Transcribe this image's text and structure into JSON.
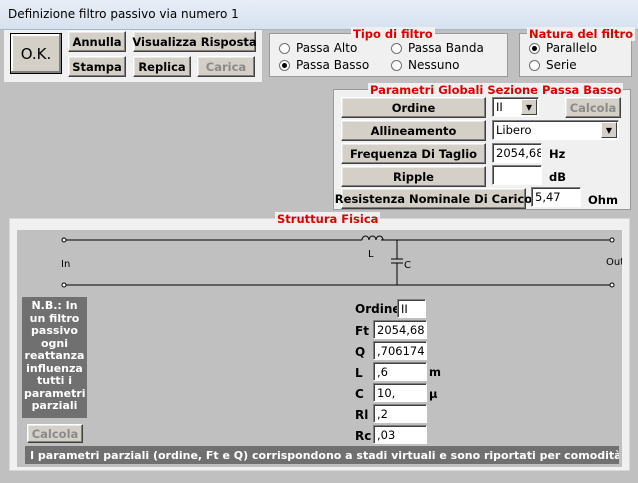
{
  "window": {
    "title": "Definizione filtro passivo via numero 1"
  },
  "toolbar": {
    "ok": "O.K.",
    "annulla": "Annulla",
    "visualizza": "Visualizza Risposta",
    "stampa": "Stampa",
    "replica": "Replica",
    "carica": "Carica"
  },
  "filter_type": {
    "title": "Tipo di filtro",
    "options": [
      {
        "label": "Passa Alto",
        "selected": false
      },
      {
        "label": "Passa Banda",
        "selected": false
      },
      {
        "label": "Passa Basso",
        "selected": true
      },
      {
        "label": "Nessuno",
        "selected": false
      }
    ]
  },
  "filter_nature": {
    "title": "Natura del filtro",
    "options": [
      {
        "label": "Parallelo",
        "selected": true
      },
      {
        "label": "Serie",
        "selected": false
      }
    ]
  },
  "global_params": {
    "title": "Parametri Globali Sezione Passa Basso",
    "ordine_label": "Ordine",
    "ordine_value": "II",
    "calcola": "Calcola",
    "allineamento_label": "Allineamento",
    "allineamento_value": "Libero",
    "freq_label": "Frequenza Di Taglio",
    "freq_value": "2054,68",
    "freq_unit": "Hz",
    "ripple_label": "Ripple",
    "ripple_value": "",
    "ripple_unit": "dB",
    "resist_label": "Resistenza Nominale Di Carico",
    "resist_value": "5,47",
    "resist_unit": "Ohm"
  },
  "structure": {
    "title": "Struttura Fisica",
    "in_label": "In",
    "out_label": "Out",
    "inductor_label": "L",
    "capacitor_label": "C",
    "note": "N.B.: In un filtro passivo ogni reattanza influenza tutti i parametri parziali",
    "calcola": "Calcola",
    "params": [
      {
        "label": "Ordine",
        "value": "II",
        "unit": ""
      },
      {
        "label": "Ft",
        "value": "2054,68",
        "unit": ""
      },
      {
        "label": "Q",
        "value": ",706174",
        "unit": ""
      },
      {
        "label": "L",
        "value": ",6",
        "unit": "m"
      },
      {
        "label": "C",
        "value": "10,",
        "unit": "µ"
      },
      {
        "label": "Rl",
        "value": ",2",
        "unit": ""
      },
      {
        "label": "Rc",
        "value": ",03",
        "unit": ""
      }
    ],
    "footer": "I parametri parziali (ordine, Ft e Q) corrispondono a stadi virtuali e sono riportati per comodità di editing"
  },
  "colors": {
    "title_red": "#e00000",
    "note_bg": "#707070",
    "group_bg": "#f0f0f0",
    "client_bg": "#c0c0c0"
  }
}
